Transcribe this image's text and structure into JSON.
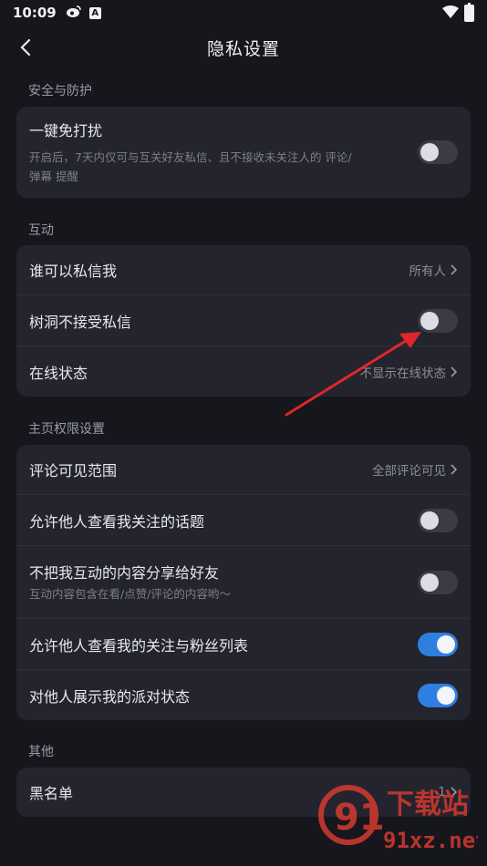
{
  "status_bar": {
    "time": "10:09",
    "badge": "A"
  },
  "nav": {
    "title": "隐私设置"
  },
  "sections": {
    "security": {
      "label": "安全与防护",
      "dnd_title": "一键免打扰",
      "dnd_desc_line1": "开启后，7天内仅可与互关好友私信、且不接收未关注人的 评论/",
      "dnd_desc_line2": "弹幕 提醒",
      "dnd_toggle": "off"
    },
    "interaction": {
      "label": "互动",
      "who_can_message": "谁可以私信我",
      "who_can_message_value": "所有人",
      "treehole_no_dm": "树洞不接受私信",
      "online_status": "在线状态",
      "online_status_value": "不显示在线状态"
    },
    "homepage": {
      "label": "主页权限设置",
      "comment_scope": "评论可见范围",
      "comment_scope_value": "全部评论可见",
      "allow_view_topics": "允许他人查看我关注的话题",
      "no_share_interactions": "不把我互动的内容分享给好友",
      "no_share_desc": "互动内容包含在看/点赞/评论的内容哟～",
      "allow_view_follow_list": "允许他人查看我的关注与粉丝列表",
      "show_party_status": "对他人展示我的派对状态"
    },
    "other": {
      "label": "其他",
      "blacklist": "黑名单",
      "blacklist_count": "1"
    }
  },
  "watermark": {
    "text_top": "下载站",
    "text_bottom": "91xz.net",
    "logo": "91"
  },
  "colors": {
    "accent": "#2f7fe0",
    "arrow": "#e0262b",
    "card": "#23242d",
    "background": "#16171d"
  }
}
